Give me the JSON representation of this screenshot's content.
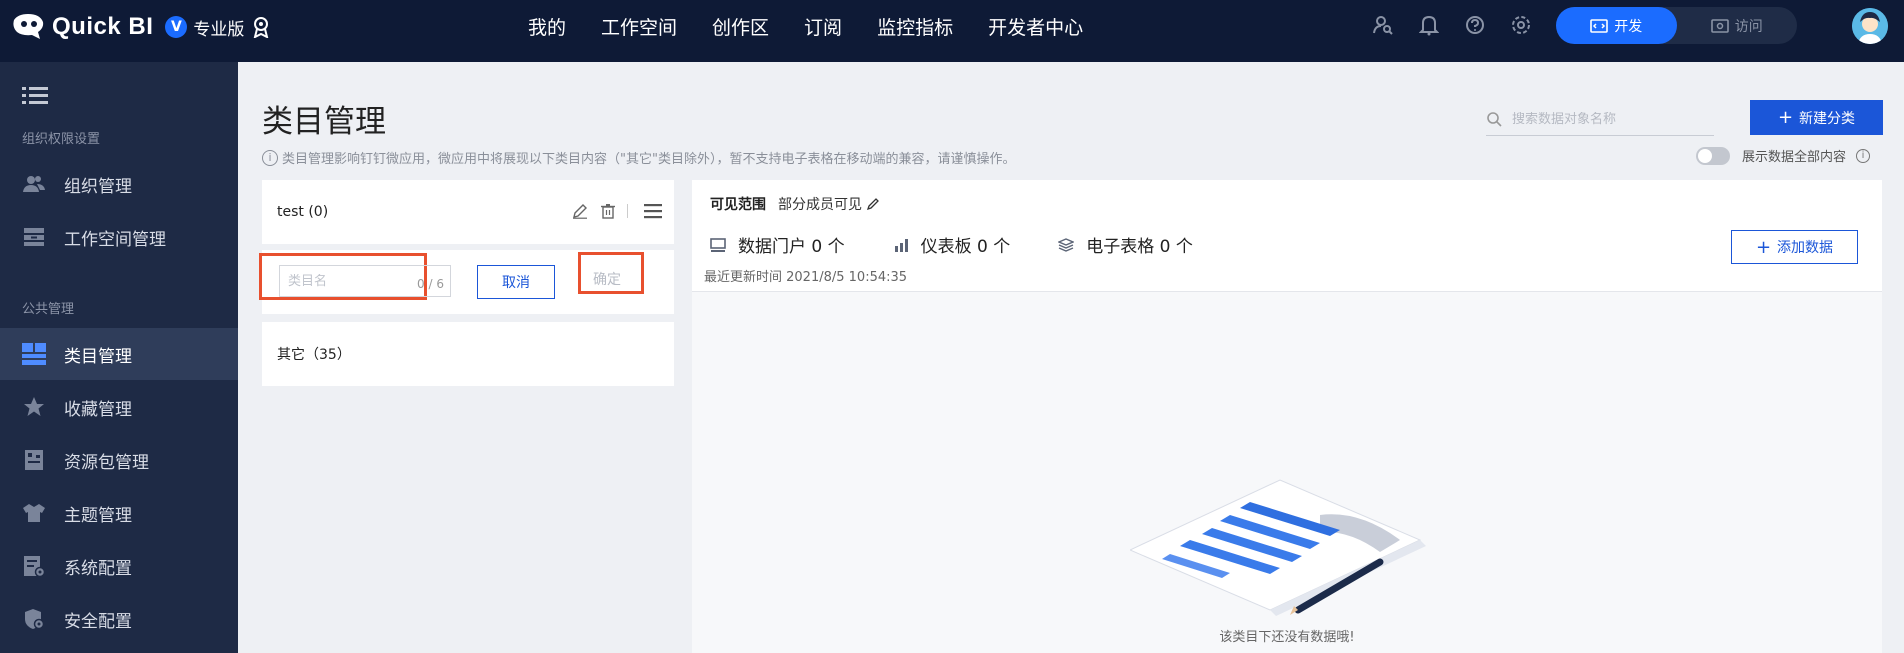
{
  "topbar": {
    "brand": "Quick BI",
    "edition_badge": "V",
    "edition": "专业版",
    "nav": [
      "我的",
      "工作空间",
      "创作区",
      "订阅",
      "监控指标",
      "开发者中心"
    ],
    "icons": [
      "search-user-icon",
      "bell-icon",
      "help-icon",
      "gear-icon"
    ],
    "modes": {
      "develop": "开发",
      "visit": "访问"
    }
  },
  "sidebar": {
    "group_org": "组织权限设置",
    "group_public": "公共管理",
    "items": [
      {
        "label": "组织管理",
        "icon": "users-icon"
      },
      {
        "label": "工作空间管理",
        "icon": "workspace-icon"
      },
      {
        "label": "类目管理",
        "icon": "category-icon",
        "active": true
      },
      {
        "label": "收藏管理",
        "icon": "star-icon"
      },
      {
        "label": "资源包管理",
        "icon": "package-icon"
      },
      {
        "label": "主题管理",
        "icon": "shirt-icon"
      },
      {
        "label": "系统配置",
        "icon": "config-icon"
      },
      {
        "label": "安全配置",
        "icon": "shield-icon"
      }
    ]
  },
  "page": {
    "title": "类目管理",
    "hint": "类目管理影响钉钉微应用，微应用中将展现以下类目内容（\"其它\"类目除外），暂不支持电子表格在移动端的兼容，请谨慎操作。",
    "search_placeholder": "搜索数据对象名称",
    "new_button": "新建分类",
    "show_all_label": "展示数据全部内容"
  },
  "categories": {
    "test_label": "test (0)",
    "input_placeholder": "类目名",
    "input_count": "0 / 6",
    "cancel": "取消",
    "confirm": "确定",
    "other_label": "其它（35）"
  },
  "detail": {
    "scope_key": "可见范围",
    "scope_value": "部分成员可见",
    "stats": [
      {
        "label": "数据门户 0 个",
        "icon": "portal-icon"
      },
      {
        "label": "仪表板 0 个",
        "icon": "dashboard-icon"
      },
      {
        "label": "电子表格 0 个",
        "icon": "spreadsheet-icon"
      }
    ],
    "updated": "最近更新时间 2021/8/5 10:54:35",
    "add_button": "添加数据",
    "empty_text": "该类目下还没有数据哦!"
  },
  "colors": {
    "topbar": "#0e1a36",
    "sidebar": "#1e2a45",
    "accent": "#1b56d8",
    "highlight": "#e8502e"
  }
}
